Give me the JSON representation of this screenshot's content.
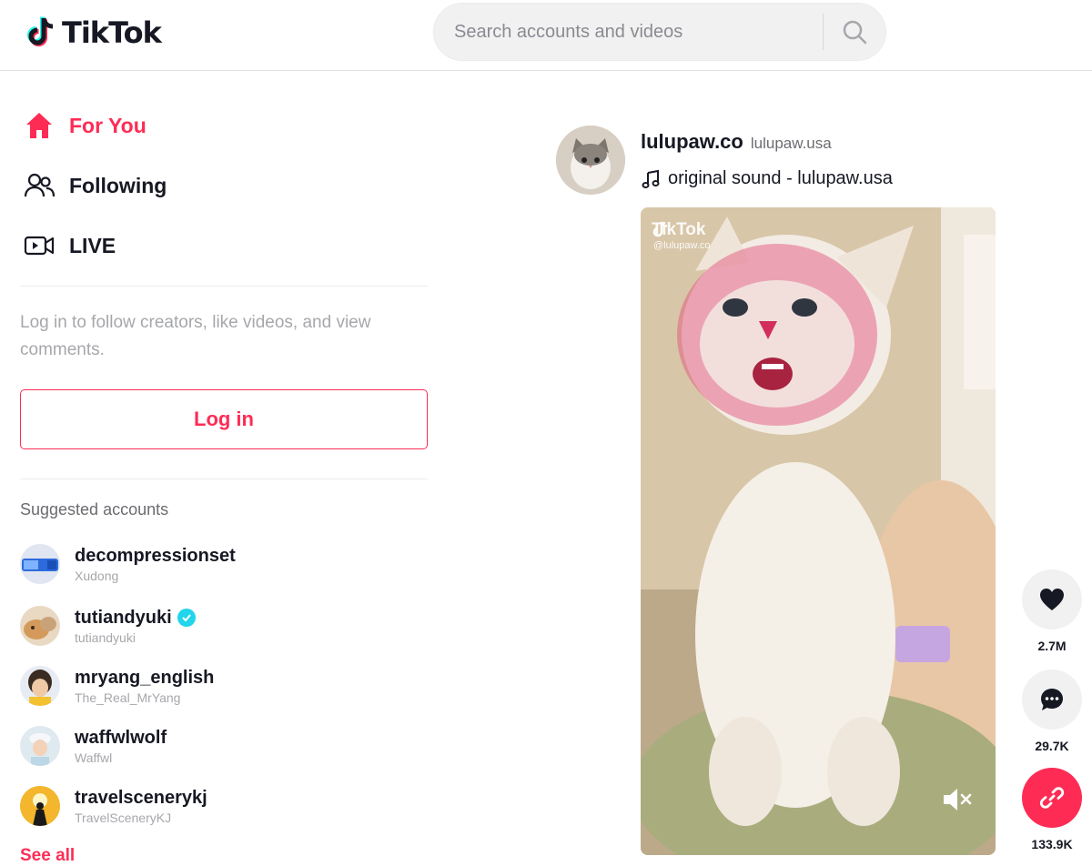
{
  "app": {
    "name": "TikTok"
  },
  "colors": {
    "brand": "#fe2c55",
    "text": "#161823",
    "muted": "#a6a7ab",
    "verified": "#20d5ec"
  },
  "search": {
    "placeholder": "Search accounts and videos",
    "value": ""
  },
  "nav": [
    {
      "label": "For You",
      "icon": "home-icon",
      "active": true
    },
    {
      "label": "Following",
      "icon": "users-icon",
      "active": false
    },
    {
      "label": "LIVE",
      "icon": "live-video-icon",
      "active": false
    }
  ],
  "login": {
    "prompt": "Log in to follow creators, like videos, and view comments.",
    "button_label": "Log in"
  },
  "suggested": {
    "title": "Suggested accounts",
    "accounts": [
      {
        "username": "decompressionset",
        "nickname": "Xudong",
        "verified": false
      },
      {
        "username": "tutiandyuki",
        "nickname": "tutiandyuki",
        "verified": true
      },
      {
        "username": "mryang_english",
        "nickname": "The_Real_MrYang",
        "verified": false
      },
      {
        "username": "waffwlwolf",
        "nickname": "Waffwl",
        "verified": false
      },
      {
        "username": "travelscenerykj",
        "nickname": "TravelSceneryKJ",
        "verified": false
      }
    ],
    "see_all": "See all"
  },
  "post": {
    "author_id": "lulupaw.co",
    "author_nickname": "lulupaw.usa",
    "sound": "original sound - lulupaw.usa",
    "watermark_logo": "TikTok",
    "watermark_user": "@lulupaw.co",
    "actions": [
      {
        "icon": "heart-icon",
        "count": "2.7M"
      },
      {
        "icon": "comment-icon",
        "count": "29.7K"
      },
      {
        "icon": "share-link-icon",
        "count": "133.9K"
      }
    ]
  }
}
